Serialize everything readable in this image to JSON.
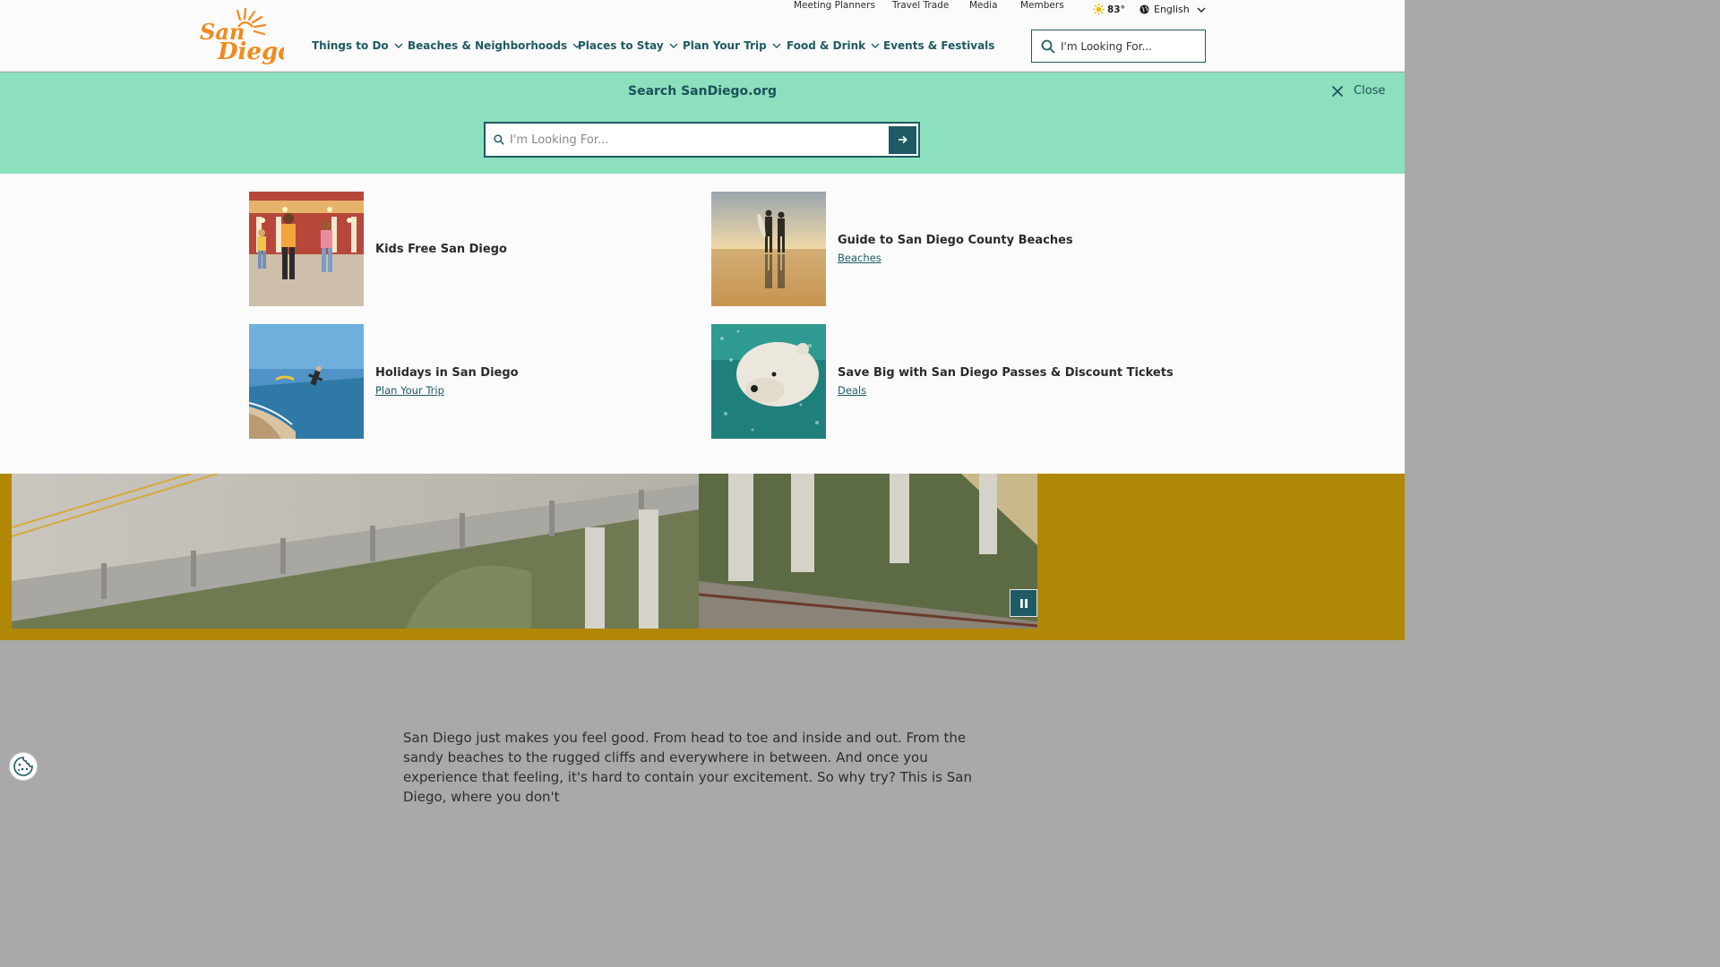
{
  "brand": {
    "logo_text": "San Diego",
    "primary": "#1e5a63",
    "accent": "#f08a1d",
    "mint": "#8ce0bd",
    "gold": "#b18805"
  },
  "utility_nav": [
    "Meeting Planners",
    "Travel Trade",
    "Media",
    "Members"
  ],
  "weather": {
    "icon": "sun-icon",
    "temp": "83°"
  },
  "language": {
    "icon": "globe-icon",
    "label": "English"
  },
  "main_nav": [
    {
      "label": "Things to Do",
      "has_dropdown": true
    },
    {
      "label": "Beaches & Neighborhoods",
      "has_dropdown": true
    },
    {
      "label": "Places to Stay",
      "has_dropdown": true
    },
    {
      "label": "Plan Your Trip",
      "has_dropdown": true
    },
    {
      "label": "Food & Drink",
      "has_dropdown": true
    },
    {
      "label": "Events & Festivals",
      "has_dropdown": false
    }
  ],
  "header_search": {
    "placeholder": "I'm Looking For..."
  },
  "search_panel": {
    "title": "Search SanDiego.org",
    "close_label": "Close",
    "placeholder": "I'm Looking For..."
  },
  "results": [
    {
      "title": "Kids Free San Diego",
      "category": ""
    },
    {
      "title": "Guide to San Diego County Beaches",
      "category": "Beaches"
    },
    {
      "title": "Holidays in San Diego",
      "category": "Plan Your Trip"
    },
    {
      "title": "Save Big with San Diego Passes & Discount Tickets",
      "category": "Deals"
    }
  ],
  "video": {
    "control_icon": "pause-icon"
  },
  "intro_text": "San Diego just makes you feel good. From head to toe and inside and out. From the sandy beaches to the rugged cliffs and everywhere in between. And once you experience that feeling, it's hard to contain your excitement. So why try? This is San Diego, where you don't"
}
